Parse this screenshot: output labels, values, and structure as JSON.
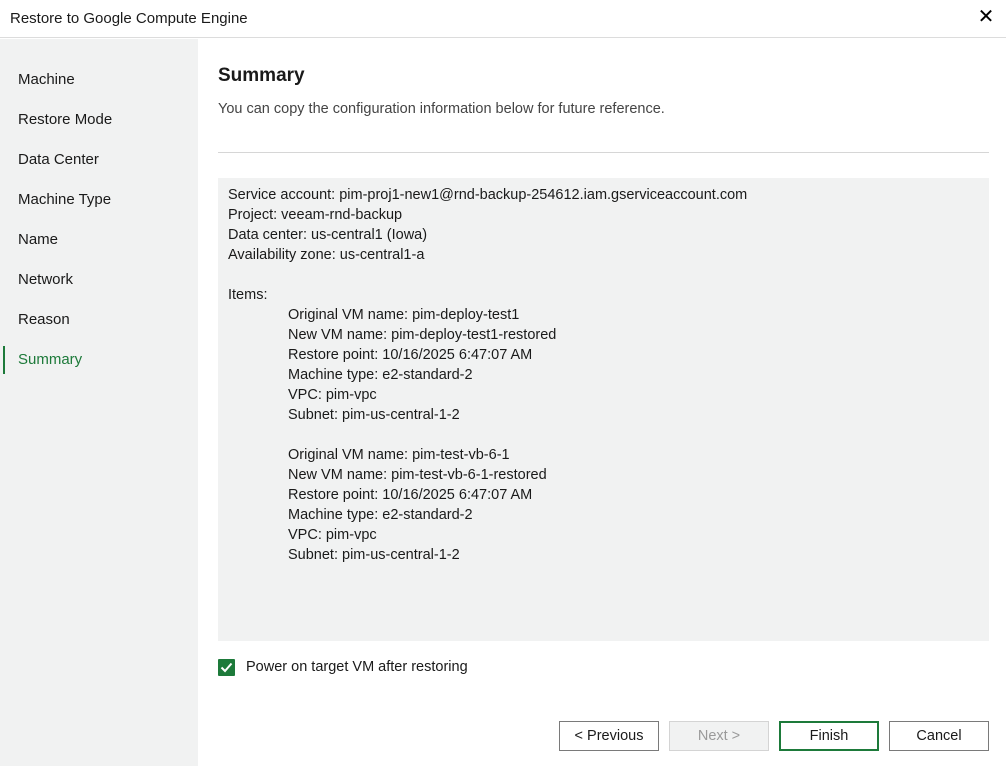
{
  "window": {
    "title": "Restore to Google Compute Engine",
    "close_icon": "close-icon"
  },
  "sidebar": {
    "items": [
      {
        "label": "Machine",
        "active": false
      },
      {
        "label": "Restore Mode",
        "active": false
      },
      {
        "label": "Data Center",
        "active": false
      },
      {
        "label": "Machine Type",
        "active": false
      },
      {
        "label": "Name",
        "active": false
      },
      {
        "label": "Network",
        "active": false
      },
      {
        "label": "Reason",
        "active": false
      },
      {
        "label": "Summary",
        "active": true
      }
    ],
    "accent_color": "#1d7a3a"
  },
  "main": {
    "heading": "Summary",
    "subtitle": "You can copy the configuration information below for future reference.",
    "summary": {
      "service_account": "Service account: pim-proj1-new1@rnd-backup-254612.iam.gserviceaccount.com",
      "project": "Project: veeam-rnd-backup",
      "data_center": "Data center: us-central1 (Iowa)",
      "availability_zone": "Availability zone: us-central1-a",
      "items_label": "Items:",
      "items": [
        {
          "original_vm": "Original VM name: pim-deploy-test1",
          "new_vm": "New VM name: pim-deploy-test1-restored",
          "restore_point": "Restore point: 10/16/2025 6:47:07 AM",
          "machine_type": "Machine type: e2-standard-2",
          "vpc": "VPC: pim-vpc",
          "subnet": "Subnet: pim-us-central-1-2"
        },
        {
          "original_vm": "Original VM name: pim-test-vb-6-1",
          "new_vm": "New VM name: pim-test-vb-6-1-restored",
          "restore_point": "Restore point: 10/16/2025 6:47:07 AM",
          "machine_type": "Machine type: e2-standard-2",
          "vpc": "VPC: pim-vpc",
          "subnet": "Subnet: pim-us-central-1-2"
        }
      ]
    },
    "power_on": {
      "label": "Power on target VM after restoring",
      "checked": true,
      "icon": "checkmark-icon"
    }
  },
  "buttons": {
    "previous": "< Previous",
    "next": "Next >",
    "next_disabled": true,
    "finish": "Finish",
    "cancel": "Cancel"
  }
}
